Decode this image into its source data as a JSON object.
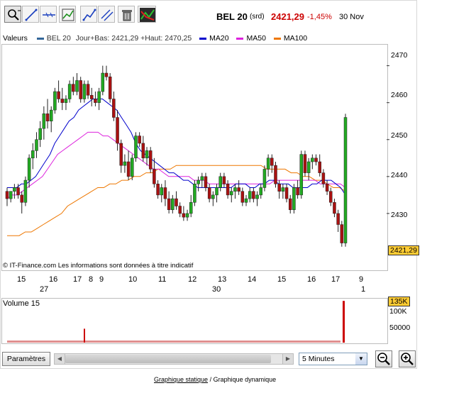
{
  "header": {
    "index_name": "BEL 20",
    "suffix": "(srd)",
    "price": "2421,29",
    "change": "-1,45%",
    "date": "30 Nov"
  },
  "toolbar": {
    "tools": [
      "zoom-icon",
      "trendline-icon",
      "horizontal-line-icon",
      "indicator-icon",
      "fibonacci-icon",
      "parallel-lines-icon",
      "trash-icon",
      "compare-icon"
    ]
  },
  "legend": {
    "label": "Valeurs",
    "series_name": "BEL 20",
    "series_desc": "Jour+Bas: 2421,29 +Haut: 2470,25",
    "ma20": "MA20",
    "ma50": "MA50",
    "ma100": "MA100"
  },
  "colors": {
    "series": "#336699",
    "ma20": "#0000cc",
    "ma50": "#dd22dd",
    "ma100": "#ee7700",
    "up": "#22aa22",
    "down": "#aa1111",
    "last_price_bg": "#ffcc33"
  },
  "chart": {
    "watermark": "© IT-Finance.com Les informations sont données à titre indicatif",
    "last_price_label": "2421,29",
    "yticks": [
      "2470",
      "2460",
      "2450",
      "2440",
      "2430"
    ],
    "xticks": [
      "15",
      "16",
      "17",
      "8",
      "9",
      "10",
      "11",
      "12",
      "13",
      "14",
      "15",
      "16",
      "17",
      "9"
    ],
    "x_groups": [
      "27",
      "30",
      "1"
    ]
  },
  "volume": {
    "label": "Volume 15",
    "current_label": "135K",
    "yticks": [
      "100K",
      "50000"
    ]
  },
  "controls": {
    "params_label": "Paramètres",
    "interval": "5 Minutes",
    "zoom_out": "zoom-out-icon",
    "zoom_in": "zoom-in-icon"
  },
  "footer": {
    "static_link": "Graphique statique",
    "separator": "/",
    "dynamic_link": "Graphique dynamique"
  },
  "chart_data": {
    "type": "candlestick",
    "ylim": [
      2420,
      2473
    ],
    "candles": [
      [
        2436,
        2437,
        2432,
        2434
      ],
      [
        2434,
        2436,
        2433,
        2436
      ],
      [
        2436,
        2438,
        2434,
        2437
      ],
      [
        2437,
        2438,
        2434,
        2435
      ],
      [
        2435,
        2436,
        2430,
        2433
      ],
      [
        2433,
        2440,
        2432,
        2439
      ],
      [
        2439,
        2446,
        2437,
        2445
      ],
      [
        2445,
        2449,
        2442,
        2447
      ],
      [
        2447,
        2452,
        2445,
        2450
      ],
      [
        2450,
        2455,
        2448,
        2453
      ],
      [
        2453,
        2459,
        2450,
        2457
      ],
      [
        2457,
        2461,
        2453,
        2455
      ],
      [
        2455,
        2459,
        2452,
        2458
      ],
      [
        2458,
        2464,
        2457,
        2463
      ],
      [
        2463,
        2466,
        2460,
        2461
      ],
      [
        2461,
        2464,
        2458,
        2460
      ],
      [
        2460,
        2462,
        2458,
        2461
      ],
      [
        2461,
        2466,
        2460,
        2465
      ],
      [
        2465,
        2467,
        2462,
        2463
      ],
      [
        2463,
        2468,
        2462,
        2466
      ],
      [
        2466,
        2467,
        2460,
        2461
      ],
      [
        2461,
        2466,
        2460,
        2465
      ],
      [
        2465,
        2466,
        2461,
        2462
      ],
      [
        2462,
        2464,
        2459,
        2461
      ],
      [
        2461,
        2463,
        2459,
        2460
      ],
      [
        2460,
        2464,
        2458,
        2463
      ],
      [
        2463,
        2470,
        2462,
        2468
      ],
      [
        2468,
        2470,
        2466,
        2467
      ],
      [
        2467,
        2468,
        2460,
        2461
      ],
      [
        2461,
        2463,
        2455,
        2456
      ],
      [
        2456,
        2458,
        2447,
        2449
      ],
      [
        2449,
        2450,
        2441,
        2443
      ],
      [
        2443,
        2446,
        2441,
        2444
      ],
      [
        2444,
        2447,
        2439,
        2440
      ],
      [
        2440,
        2446,
        2439,
        2445
      ],
      [
        2445,
        2452,
        2444,
        2451
      ],
      [
        2451,
        2452,
        2448,
        2449
      ],
      [
        2449,
        2451,
        2444,
        2445
      ],
      [
        2445,
        2448,
        2443,
        2447
      ],
      [
        2447,
        2448,
        2441,
        2442
      ],
      [
        2442,
        2445,
        2437,
        2438
      ],
      [
        2438,
        2439,
        2434,
        2435
      ],
      [
        2435,
        2438,
        2433,
        2437
      ],
      [
        2437,
        2439,
        2432,
        2434
      ],
      [
        2434,
        2436,
        2430,
        2431
      ],
      [
        2431,
        2435,
        2430,
        2434
      ],
      [
        2434,
        2436,
        2431,
        2432
      ],
      [
        2432,
        2433,
        2429,
        2430
      ],
      [
        2430,
        2432,
        2428,
        2429
      ],
      [
        2429,
        2431,
        2428,
        2430
      ],
      [
        2430,
        2435,
        2429,
        2433
      ],
      [
        2433,
        2439,
        2432,
        2438
      ],
      [
        2438,
        2440,
        2436,
        2439
      ],
      [
        2439,
        2441,
        2437,
        2440
      ],
      [
        2440,
        2441,
        2436,
        2437
      ],
      [
        2437,
        2438,
        2433,
        2434
      ],
      [
        2434,
        2436,
        2432,
        2435
      ],
      [
        2435,
        2438,
        2433,
        2437
      ],
      [
        2437,
        2441,
        2436,
        2440
      ],
      [
        2440,
        2441,
        2437,
        2438
      ],
      [
        2438,
        2439,
        2434,
        2435
      ],
      [
        2435,
        2437,
        2433,
        2436
      ],
      [
        2436,
        2438,
        2434,
        2437
      ],
      [
        2437,
        2439,
        2435,
        2436
      ],
      [
        2436,
        2437,
        2432,
        2433
      ],
      [
        2433,
        2435,
        2432,
        2434
      ],
      [
        2434,
        2437,
        2433,
        2436
      ],
      [
        2436,
        2437,
        2433,
        2434
      ],
      [
        2434,
        2436,
        2432,
        2435
      ],
      [
        2435,
        2438,
        2434,
        2437
      ],
      [
        2437,
        2443,
        2436,
        2442
      ],
      [
        2442,
        2446,
        2440,
        2445
      ],
      [
        2445,
        2446,
        2441,
        2443
      ],
      [
        2443,
        2444,
        2437,
        2438
      ],
      [
        2438,
        2439,
        2434,
        2436
      ],
      [
        2436,
        2438,
        2434,
        2437
      ],
      [
        2437,
        2438,
        2433,
        2434
      ],
      [
        2434,
        2435,
        2430,
        2431
      ],
      [
        2431,
        2438,
        2430,
        2437
      ],
      [
        2437,
        2439,
        2434,
        2435
      ],
      [
        2435,
        2447,
        2434,
        2446
      ],
      [
        2446,
        2447,
        2440,
        2441
      ],
      [
        2441,
        2445,
        2439,
        2444
      ],
      [
        2444,
        2446,
        2442,
        2445
      ],
      [
        2445,
        2446,
        2443,
        2444
      ],
      [
        2444,
        2446,
        2440,
        2441
      ],
      [
        2441,
        2442,
        2437,
        2438
      ],
      [
        2438,
        2439,
        2435,
        2436
      ],
      [
        2436,
        2437,
        2432,
        2433
      ],
      [
        2433,
        2434,
        2429,
        2430
      ],
      [
        2430,
        2431,
        2425,
        2427
      ],
      [
        2427,
        2428,
        2421,
        2422
      ],
      [
        2422,
        2457,
        2421,
        2456
      ]
    ],
    "ma20": [
      2437,
      2437,
      2437,
      2438,
      2438,
      2439,
      2440,
      2442,
      2444,
      2446,
      2449,
      2451,
      2453,
      2455,
      2456,
      2458,
      2459,
      2460,
      2461,
      2461,
      2461,
      2460,
      2459,
      2458,
      2456,
      2454,
      2452,
      2449,
      2447,
      2446,
      2445,
      2444,
      2443,
      2442,
      2441,
      2441,
      2440,
      2439,
      2439,
      2438,
      2437,
      2437,
      2437,
      2437,
      2437,
      2437,
      2437,
      2437,
      2438,
      2438,
      2438,
      2437,
      2437,
      2438,
      2438,
      2439,
      2439,
      2438,
      2438,
      2438,
      2437,
      2437,
      2437,
      2437,
      2438,
      2438,
      2439,
      2439,
      2439,
      2438,
      2437,
      2435
    ],
    "ma50": [
      2434,
      2435,
      2435,
      2436,
      2437,
      2438,
      2439,
      2440,
      2442,
      2444,
      2446,
      2447,
      2448,
      2449,
      2450,
      2451,
      2452,
      2452,
      2452,
      2451,
      2451,
      2450,
      2449,
      2448,
      2447,
      2446,
      2445,
      2444,
      2443,
      2442,
      2442,
      2441,
      2440,
      2440,
      2440,
      2440,
      2440,
      2439,
      2439,
      2439,
      2438,
      2438,
      2438,
      2438,
      2438,
      2438,
      2438,
      2438,
      2438,
      2438,
      2438,
      2438,
      2438,
      2439,
      2439,
      2439,
      2439,
      2439,
      2439,
      2439,
      2439,
      2439,
      2438,
      2438,
      2438,
      2438,
      2438,
      2437
    ],
    "ma100": [
      2424,
      2424,
      2424,
      2425,
      2425,
      2426,
      2427,
      2428,
      2429,
      2430,
      2432,
      2433,
      2434,
      2435,
      2436,
      2437,
      2437,
      2438,
      2438,
      2439,
      2439,
      2440,
      2440,
      2441,
      2441,
      2442,
      2442,
      2442,
      2443,
      2443,
      2443,
      2443,
      2443,
      2443,
      2443,
      2443,
      2443,
      2443,
      2443,
      2443,
      2443,
      2443,
      2443,
      2442,
      2442,
      2442,
      2442,
      2441,
      2441,
      2440,
      2440,
      2439,
      2439,
      2438,
      2437,
      2437,
      2436
    ],
    "volume": {
      "spike_left": 45,
      "spike_right": 135,
      "ylim": [
        0,
        140
      ]
    }
  }
}
